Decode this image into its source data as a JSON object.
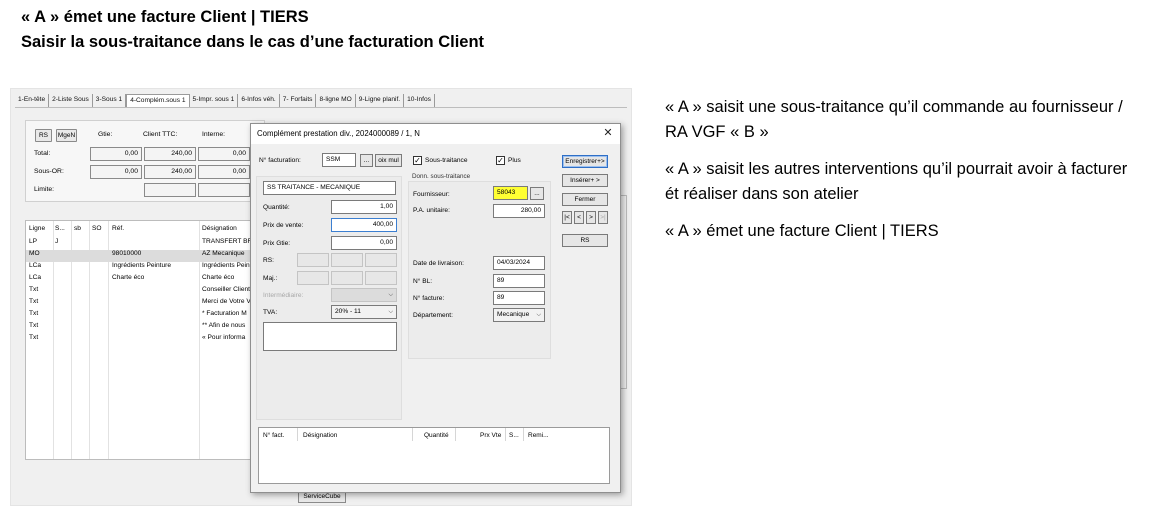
{
  "heading": {
    "line1": "« A » émet une facture Client | TIERS",
    "line2": "Saisir la sous-traitance dans le cas d’une facturation Client"
  },
  "notes": [
    "« A » saisit une sous-traitance qu’il commande au fournisseur / RA VGF « B »",
    "« A » saisit les autres interventions qu’il pourrait avoir à facturer ét réaliser dans son atelier",
    "« A » émet une facture Client | TIERS"
  ],
  "tabs": [
    "1-En-tête",
    "2-Liste Sous",
    "3-Sous 1",
    "4-Complém.sous 1",
    "5-Impr. sous 1",
    "6-Infos véh.",
    "7- Forfaits",
    "8-ligne MO",
    "9-Ligne planif.",
    "10-Infos"
  ],
  "summary": {
    "rs_button": "RS",
    "mgen_button": "MgeN",
    "col_gtie": "Gtie:",
    "col_client": "Client TTC:",
    "col_interne": "Interne:",
    "total_label": "Total:",
    "total_gtie": "0,00",
    "total_client": "240,00",
    "total_interne": "0,00",
    "sousor_label": "Sous-OR:",
    "sousor_gtie": "0,00",
    "sousor_client": "240,00",
    "sousor_interne": "0,00",
    "limite_label": "Limite:"
  },
  "grid": {
    "headers": {
      "ligne": "Ligne",
      "s": "S...",
      "sb": "sb",
      "so": "SO",
      "ref": "Réf.",
      "des": "Désignation"
    },
    "rows": [
      {
        "ligne": "LP",
        "s": "J",
        "ref": "",
        "des": "TRANSFERT BR"
      },
      {
        "ligne": "MO",
        "s": "",
        "ref": "98010000",
        "des": "AZ Mecanique"
      },
      {
        "ligne": "LCa",
        "s": "",
        "ref": "Ingrédients Peinture",
        "des": "Ingrédients Pein"
      },
      {
        "ligne": "LCa",
        "s": "",
        "ref": "Charte éco",
        "des": "Charte éco"
      },
      {
        "ligne": "Txt",
        "s": "",
        "ref": "",
        "des": "Conseiller Client"
      },
      {
        "ligne": "Txt",
        "s": "",
        "ref": "",
        "des": "Merci de Votre V"
      },
      {
        "ligne": "Txt",
        "s": "",
        "ref": "",
        "des": "* Facturation M"
      },
      {
        "ligne": "Txt",
        "s": "",
        "ref": "",
        "des": "** Afin de nous"
      },
      {
        "ligne": "Txt",
        "s": "",
        "ref": "",
        "des": "« Pour informa"
      }
    ]
  },
  "servicecube_button": "ServiceCube",
  "dialog": {
    "title": "Complément prestation div., 2024000089 / 1, N",
    "nofacturation_label": "N° facturation:",
    "nofacturation_value": "SSM",
    "dots_button": "...",
    "choix_button": "oix mul",
    "sous_traitance_label": "Sous-traitance",
    "plus_label": "Plus",
    "designation_value": "SS TRAITANCE - MECANIQUE",
    "quantite_label": "Quantité:",
    "quantite_value": "1,00",
    "prix_vente_label": "Prix de vente:",
    "prix_vente_value": "400,00",
    "prix_gtie_label": "Prix Gtie:",
    "prix_gtie_value": "0,00",
    "rs_label": "RS:",
    "maj_label": "Maj.:",
    "intermediaire_label": "Intermédiaire:",
    "tva_label": "TVA:",
    "tva_value": "20% - 11",
    "donn_title": "Donn. sous-traitance",
    "fournisseur_label": "Fournisseur:",
    "fournisseur_value": "58043",
    "pa_label": "P.A. unitaire:",
    "pa_value": "280,00",
    "date_label": "Date de livraison:",
    "date_value": "04/03/2024",
    "nbl_label": "N° BL:",
    "nbl_value": "89",
    "nfacture_label": "N° facture:",
    "nfacture_value": "89",
    "departement_label": "Département:",
    "departement_value": "Mecanique",
    "buttons": {
      "enregistrer": "Enregistrer+>",
      "inserer": "Insérer+ >",
      "fermer": "Fermer",
      "first": "|<",
      "prev": "<",
      "next": ">",
      "last": ">|",
      "rs": "RS"
    },
    "bottom_headers": {
      "nfact": "N° fact.",
      "designation": "Désignation",
      "quantite": "Quantité",
      "prxvte": "Prx Vte",
      "s": "S...",
      "remi": "Remi..."
    }
  },
  "colors": {
    "highlight": "#ffff33",
    "window_bg": "#f0f0f0",
    "focus_border": "#3c7fd1"
  }
}
